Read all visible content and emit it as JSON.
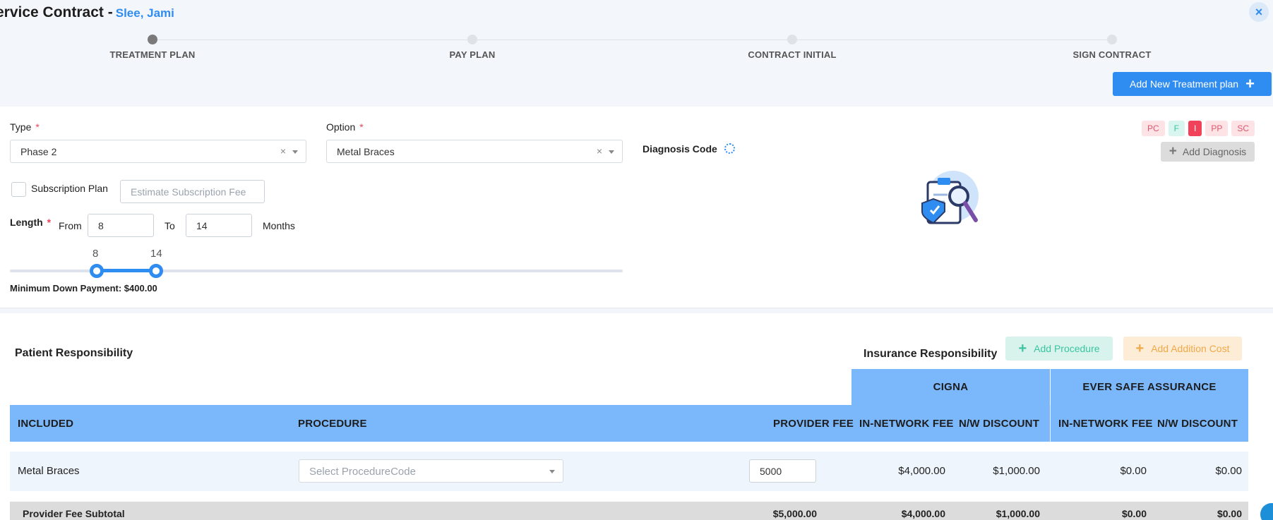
{
  "header": {
    "title": "ervice Contract -",
    "patient_name": "Slee, Jami",
    "close_label": "×"
  },
  "steps": [
    {
      "label": "TREATMENT PLAN",
      "active": true
    },
    {
      "label": "PAY PLAN",
      "active": false
    },
    {
      "label": "CONTRACT INITIAL",
      "active": false
    },
    {
      "label": "SIGN CONTRACT",
      "active": false
    }
  ],
  "add_plan_button": {
    "label": "Add New Treatment plan",
    "icon": "plus-icon"
  },
  "form": {
    "type_label": "Type",
    "type_value": "Phase 2",
    "option_label": "Option",
    "option_value": "Metal Braces",
    "required_mark": "*",
    "clear_mark": "×",
    "subscription_label": "Subscription Plan",
    "subscription_placeholder": "Estimate Subscription Fee",
    "length_label": "Length",
    "from_label": "From",
    "from_value": "8",
    "to_label": "To",
    "to_value": "14",
    "months_label": "Months",
    "slider_min_label": "8",
    "slider_max_label": "14",
    "slider_range": {
      "from": 8,
      "to": 14,
      "scale_max": 80
    },
    "min_down_payment": "Minimum Down Payment: $400.00"
  },
  "diagnosis": {
    "label": "Diagnosis Code",
    "settings_icon": "gear-icon",
    "add_label": "Add Diagnosis",
    "illustration_icon": "clipboard-search-icon",
    "badges": [
      {
        "label": "PC",
        "bg": "#fde3e6",
        "fg": "#e0566b"
      },
      {
        "label": "F",
        "bg": "#d9f5ef",
        "fg": "#3cc4a0"
      },
      {
        "label": "I",
        "bg": "#f0435a",
        "fg": "#ffffff"
      },
      {
        "label": "PP",
        "bg": "#fde3e6",
        "fg": "#e0566b"
      },
      {
        "label": "SC",
        "bg": "#fde3e6",
        "fg": "#e0566b"
      }
    ]
  },
  "responsibility": {
    "patient_title": "Patient Responsibility",
    "insurance_title": "Insurance Responsibility",
    "add_procedure": "Add Procedure",
    "add_addition_cost": "Add Addition Cost"
  },
  "table": {
    "insurers": [
      "CIGNA",
      "EVER SAFE ASSURANCE"
    ],
    "headers": {
      "included": "INCLUDED",
      "procedure": "PROCEDURE",
      "provider_fee": "PROVIDER FEE",
      "in_network_fee_1": "IN-NETWORK FEE",
      "nw_discount_1": "N/W DISCOUNT",
      "in_network_fee_2": "IN-NETWORK FEE",
      "nw_discount_2": "N/W DISCOUNT"
    },
    "row": {
      "included": "Metal Braces",
      "procedure_placeholder": "Select ProcedureCode",
      "provider_fee": "5000",
      "in_network_fee_1": "$4,000.00",
      "nw_discount_1": "$1,000.00",
      "in_network_fee_2": "$0.00",
      "nw_discount_2": "$0.00"
    },
    "subtotal": {
      "label": "Provider Fee Subtotal",
      "provider_fee": "$5,000.00",
      "in_network_fee_1": "$4,000.00",
      "nw_discount_1": "$1,000.00",
      "in_network_fee_2": "$0.00",
      "nw_discount_2": "$0.00"
    }
  }
}
